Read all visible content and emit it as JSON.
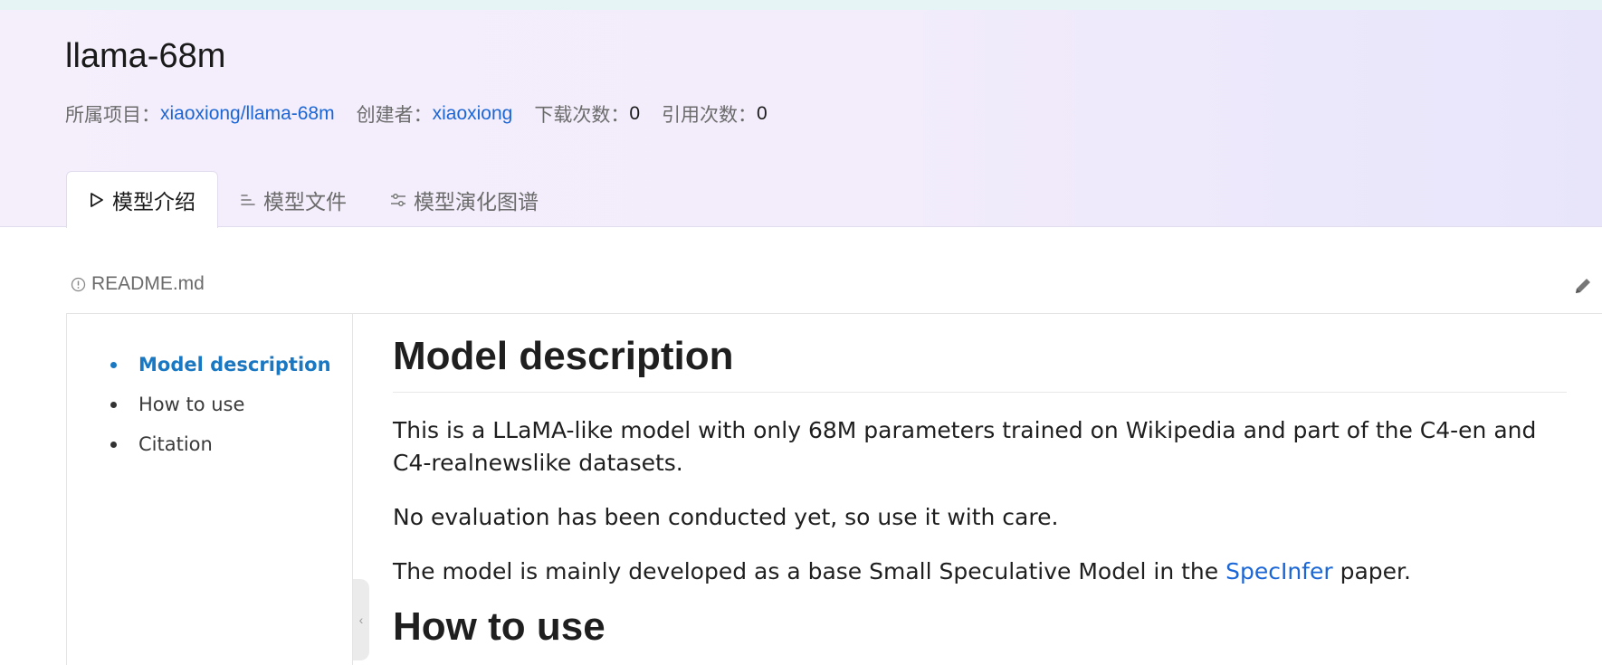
{
  "model": {
    "title": "llama-68m",
    "project_label": "所属项目：",
    "project_link": "xiaoxiong/llama-68m",
    "creator_label": "创建者：",
    "creator_link": "xiaoxiong",
    "downloads_label": "下载次数：",
    "downloads_value": "0",
    "citations_label": "引用次数：",
    "citations_value": "0"
  },
  "tabs": [
    {
      "label": "模型介绍",
      "icon": "play-outline-icon",
      "active": true
    },
    {
      "label": "模型文件",
      "icon": "list-lines-icon",
      "active": false
    },
    {
      "label": "模型演化图谱",
      "icon": "sliders-icon",
      "active": false
    }
  ],
  "readme": {
    "filename": "README.md",
    "info_icon": "info-circle-icon",
    "edit_icon": "pencil-icon"
  },
  "toc": {
    "items": [
      {
        "label": "Model description",
        "active": true
      },
      {
        "label": "How to use",
        "active": false
      },
      {
        "label": "Citation",
        "active": false
      }
    ]
  },
  "content": {
    "heading1": "Model description",
    "para1": "This is a LLaMA-like model with only 68M parameters trained on Wikipedia and part of the C4-en and C4-realnewslike datasets.",
    "para2": "No evaluation has been conducted yet, so use it with care.",
    "para3_before": "The model is mainly developed as a base Small Speculative Model in the ",
    "para3_link": "SpecInfer",
    "para3_after": " paper.",
    "heading2": "How to use"
  },
  "colors": {
    "link": "#1a66d6",
    "toc_active": "#1a78c2",
    "header_bg": "#f3edfb"
  }
}
